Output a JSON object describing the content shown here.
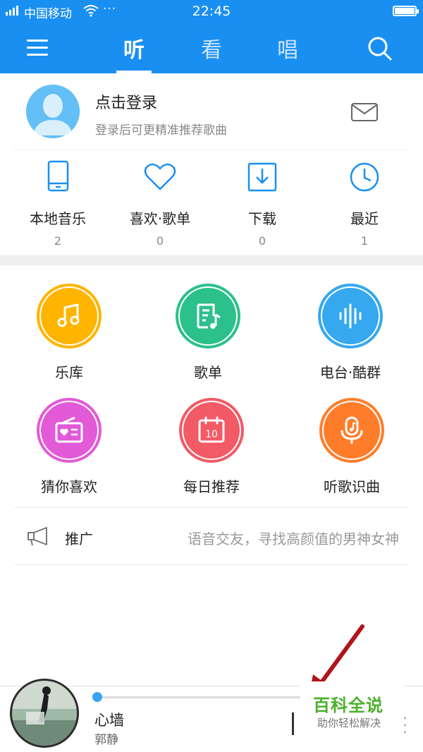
{
  "status_bar": {
    "carrier": "中国移动",
    "dots": "···",
    "time": "22:45"
  },
  "header": {
    "tabs": [
      {
        "label": "听",
        "active": true
      },
      {
        "label": "看",
        "active": false
      },
      {
        "label": "唱",
        "active": false
      }
    ],
    "accent_color": "#1a8ff2"
  },
  "profile": {
    "title": "点击登录",
    "subtitle": "登录后可更精准推荐歌曲"
  },
  "quick_items": [
    {
      "label": "本地音乐",
      "count": "2",
      "icon": "phone-icon"
    },
    {
      "label": "喜欢·歌单",
      "count": "0",
      "icon": "heart-icon"
    },
    {
      "label": "下载",
      "count": "0",
      "icon": "download-icon"
    },
    {
      "label": "最近",
      "count": "1",
      "icon": "clock-icon"
    }
  ],
  "grid": [
    {
      "label": "乐库",
      "color": "#ffb400",
      "icon": "music-note-icon"
    },
    {
      "label": "歌单",
      "color": "#2cc08c",
      "icon": "playlist-icon"
    },
    {
      "label": "电台·酷群",
      "color": "#35a8f0",
      "icon": "waveform-icon"
    },
    {
      "label": "猜你喜欢",
      "color": "#e25ad8",
      "icon": "radio-icon"
    },
    {
      "label": "每日推荐",
      "color": "#f25a66",
      "icon": "calendar-icon"
    },
    {
      "label": "听歌识曲",
      "color": "#ff7d2a",
      "icon": "mic-note-icon"
    }
  ],
  "calendar_day": "10",
  "promo": {
    "label": "推广",
    "text": "语音交友，寻找高颜值的男神女神"
  },
  "player": {
    "song": "心墙",
    "artist": "郭静",
    "progress": 0.02
  },
  "watermark": {
    "title": "百科全说",
    "subtitle": "助你轻松解决"
  }
}
